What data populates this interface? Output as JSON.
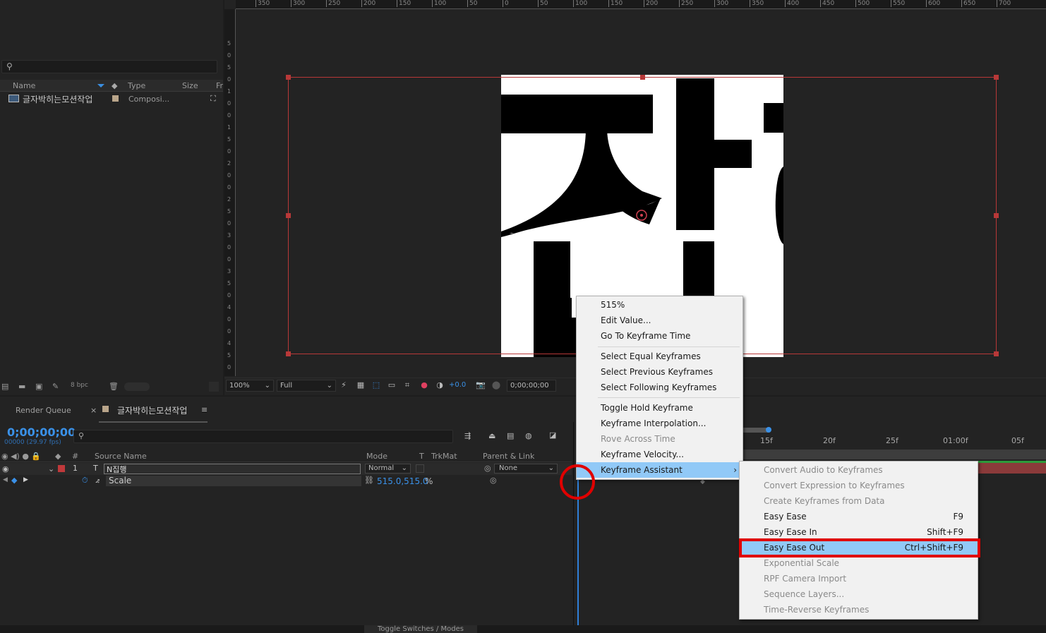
{
  "project": {
    "columns": {
      "name": "Name",
      "type": "Type",
      "size": "Size",
      "fr": "Fr"
    },
    "item": {
      "name": "글자박히는모션작업",
      "type": "Composi..."
    },
    "bpc": "8 bpc"
  },
  "viewer": {
    "ruler_top": [
      "350",
      "300",
      "250",
      "200",
      "150",
      "100",
      "50",
      "0",
      "50",
      "100",
      "150",
      "200",
      "250",
      "300",
      "350",
      "400",
      "450",
      "500",
      "550",
      "600",
      "650",
      "700"
    ],
    "ruler_left": [
      "5",
      "0",
      "5",
      "0",
      "1",
      "0",
      "0",
      "1",
      "5",
      "0",
      "2",
      "0",
      "0",
      "2",
      "5",
      "0",
      "3",
      "0",
      "0",
      "3",
      "5",
      "0",
      "4",
      "0",
      "0",
      "4",
      "5",
      "0"
    ],
    "canvas_text_1": "자",
    "canvas_text_2": "ㅂ",
    "zoom": "100%",
    "resolution": "Full",
    "exposure": "+0.0",
    "timecode": "0;00;00;00"
  },
  "timeline": {
    "tab_render_queue": "Render Queue",
    "tab_close": "×",
    "tab_comp": "글자박히는모션작업",
    "tab_menu": "≡",
    "timecode": "0;00;00;00",
    "fps": "00000 (29.97 fps)",
    "headers": {
      "num": "#",
      "source": "Source Name",
      "mode": "Mode",
      "t": "T",
      "trkmat": "TrkMat",
      "parent": "Parent & Link"
    },
    "layer": {
      "num": "1",
      "type_icon": "T",
      "name": "N집행",
      "mode": "Normal",
      "parent": "None"
    },
    "prop": {
      "name": "Scale",
      "value": "515.0,515.0",
      "unit": "%"
    },
    "ruler_labels": [
      "15f",
      "20f",
      "25f",
      "01:00f",
      "05f"
    ],
    "toggle_label": "Toggle Switches / Modes"
  },
  "menu_main": {
    "items": [
      {
        "label": "515%"
      },
      {
        "label": "Edit Value..."
      },
      {
        "label": "Go To Keyframe Time"
      },
      {
        "label": "Select Equal Keyframes"
      },
      {
        "label": "Select Previous Keyframes"
      },
      {
        "label": "Select Following Keyframes"
      },
      {
        "label": "Toggle Hold Keyframe"
      },
      {
        "label": "Keyframe Interpolation..."
      },
      {
        "label": "Rove Across Time"
      },
      {
        "label": "Keyframe Velocity..."
      },
      {
        "label": "Keyframe Assistant"
      }
    ],
    "submenu_arrow": "›"
  },
  "menu_sub": {
    "items": [
      {
        "label": "Convert Audio to Keyframes",
        "shortcut": ""
      },
      {
        "label": "Convert Expression to Keyframes",
        "shortcut": ""
      },
      {
        "label": "Create Keyframes from Data",
        "shortcut": ""
      },
      {
        "label": "Easy Ease",
        "shortcut": "F9"
      },
      {
        "label": "Easy Ease In",
        "shortcut": "Shift+F9"
      },
      {
        "label": "Easy Ease Out",
        "shortcut": "Ctrl+Shift+F9"
      },
      {
        "label": "Exponential Scale",
        "shortcut": ""
      },
      {
        "label": "RPF Camera Import",
        "shortcut": ""
      },
      {
        "label": "Sequence Layers...",
        "shortcut": ""
      },
      {
        "label": "Time-Reverse Keyframes",
        "shortcut": ""
      }
    ]
  },
  "colors": {
    "accent": "#2f7fd8",
    "highlight": "#91c9f7",
    "annotation": "#e00000",
    "bbox": "#b83838"
  }
}
